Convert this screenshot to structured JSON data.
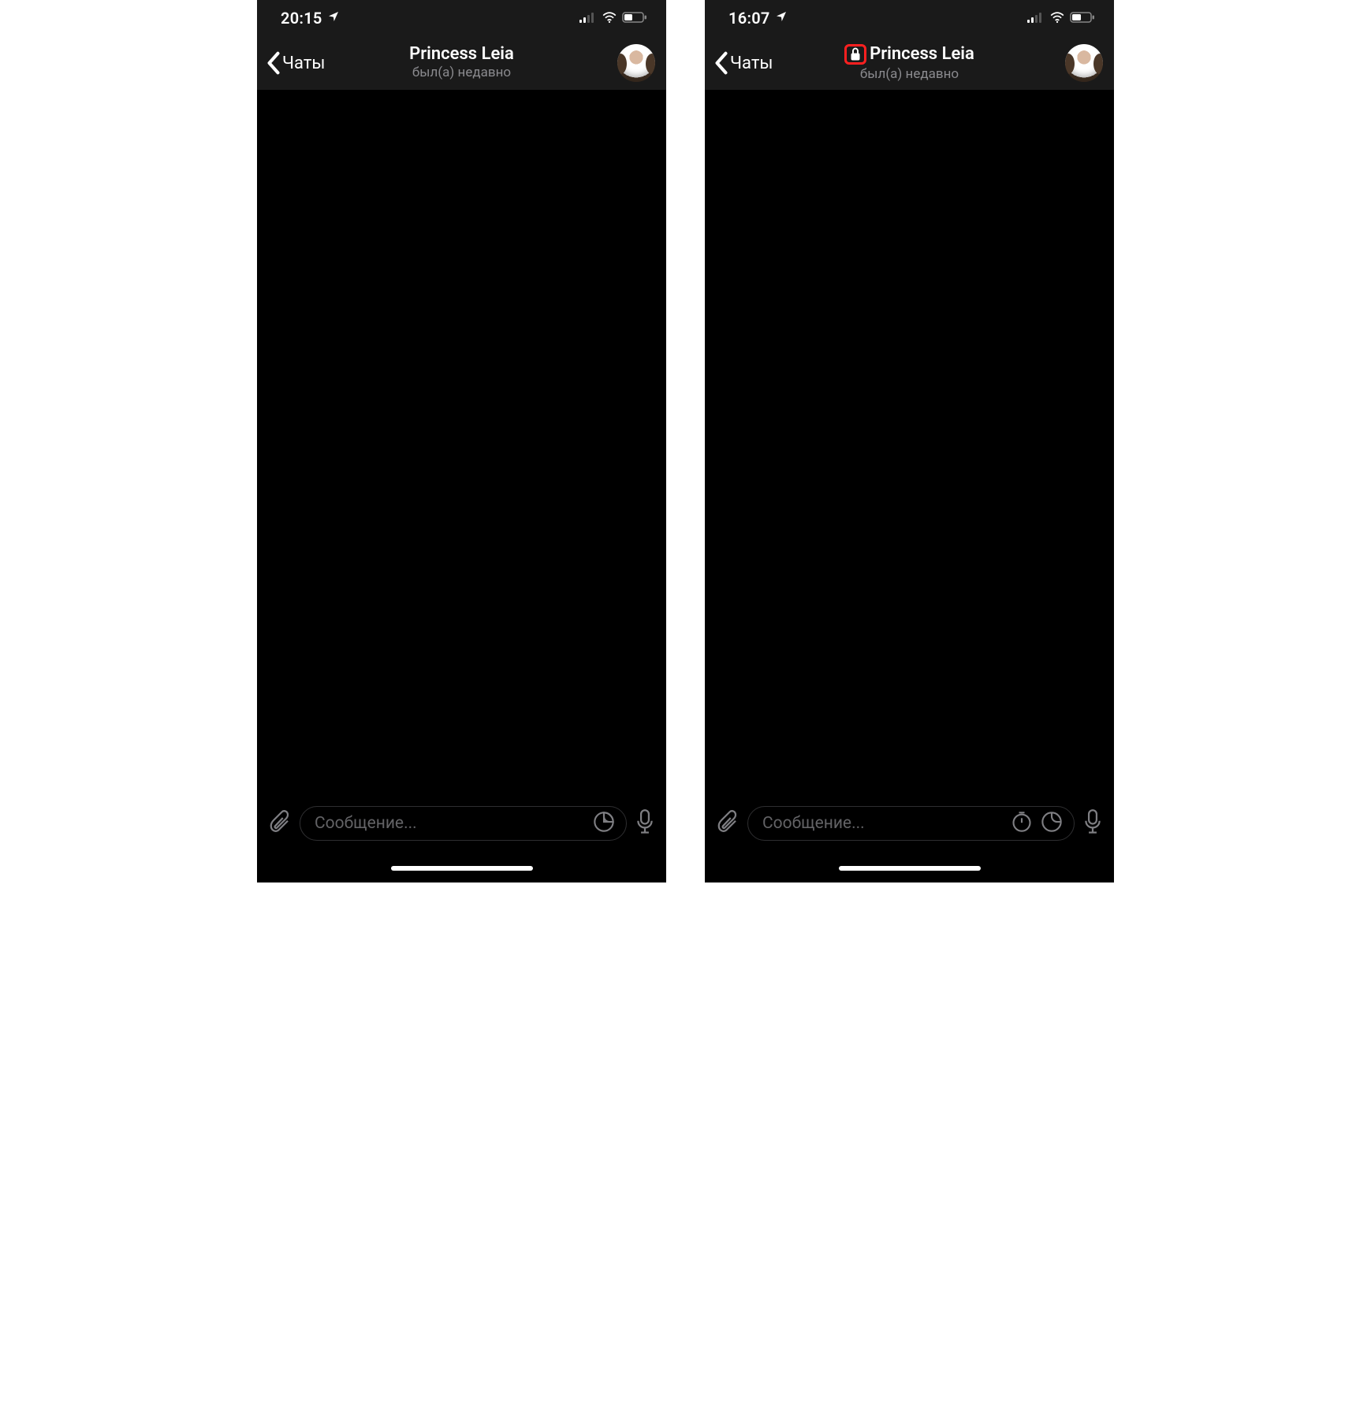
{
  "screens": [
    {
      "status": {
        "time": "20:15",
        "has_location": true
      },
      "header": {
        "back_label": "Чаты",
        "show_lock": false,
        "title": "Princess Leia",
        "status_text": "был(а) недавно"
      },
      "composer": {
        "placeholder": "Сообщение...",
        "show_timer_icon": false,
        "show_sticker_icon": true
      }
    },
    {
      "status": {
        "time": "16:07",
        "has_location": true
      },
      "header": {
        "back_label": "Чаты",
        "show_lock": true,
        "title": "Princess Leia",
        "status_text": "был(а) недавно"
      },
      "composer": {
        "placeholder": "Сообщение...",
        "show_timer_icon": true,
        "show_sticker_icon": true
      }
    }
  ],
  "icons": {
    "attachment": "attachment-icon",
    "sticker": "sticker-icon",
    "timer": "timer-icon",
    "mic": "mic-icon",
    "lock": "lock-icon"
  },
  "colors": {
    "header_bg": "#1a1a1a",
    "body_bg": "#000000",
    "secondary_text": "#8a8a8e",
    "placeholder": "#636366",
    "highlight_box": "#ff2020"
  }
}
